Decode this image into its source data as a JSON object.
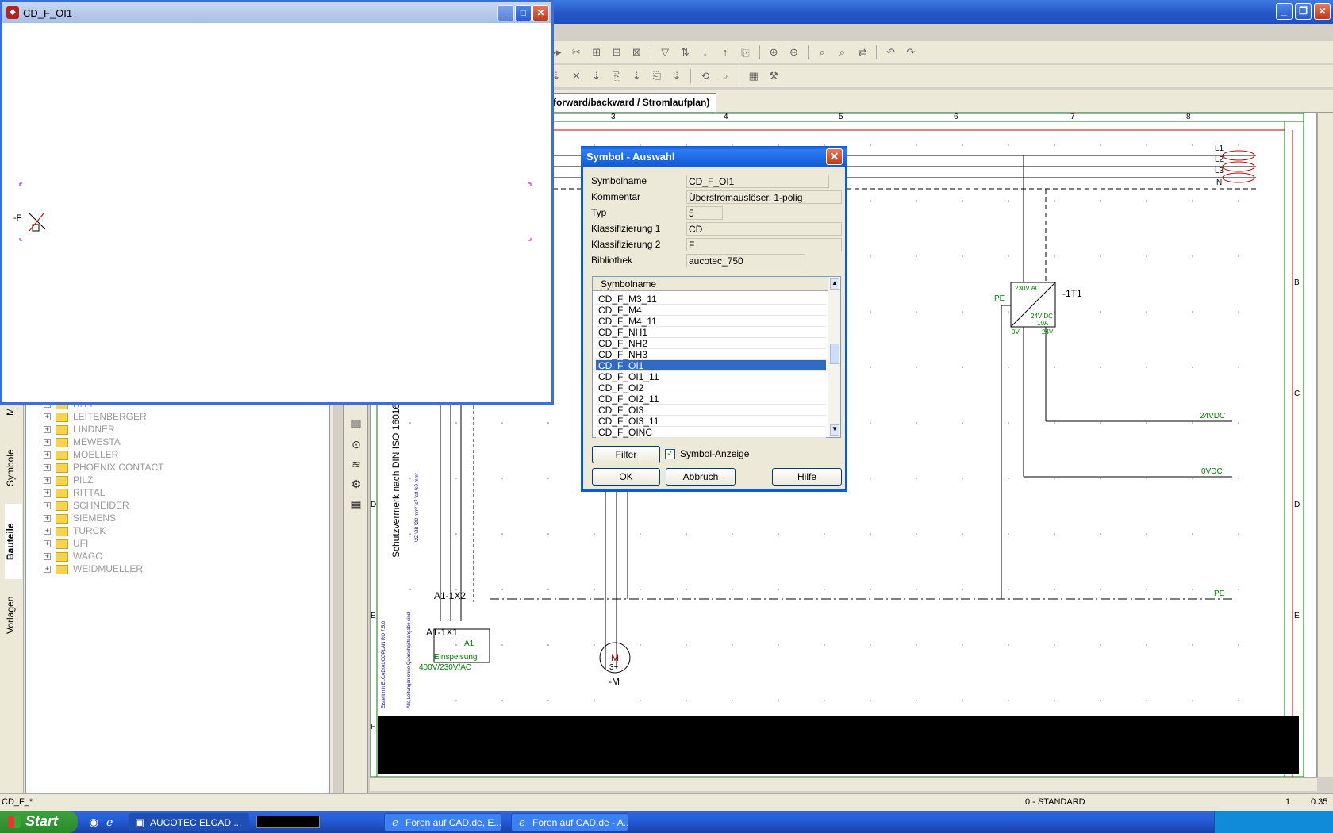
{
  "preview_window": {
    "title": "CD_F_OI1",
    "symbol_label": "-F"
  },
  "main_window": {
    "tab_label": "forward/backward / Stromlaufplan)"
  },
  "left_panel": {
    "tabs": [
      "Vorlagen",
      "Bauteile",
      "Symbole"
    ],
    "tree_items": [
      "RITT",
      "LEITENBERGER",
      "LINDNER",
      "MEWESTA",
      "MOELLER",
      "PHOENIX CONTACT",
      "PILZ",
      "RITTAL",
      "SCHNEIDER",
      "SIEMENS",
      "TURCK",
      "UFI",
      "WAGO",
      "WEIDMUELLER"
    ]
  },
  "drawing": {
    "column_numbers": [
      "3",
      "4",
      "5",
      "6",
      "7",
      "8"
    ],
    "row_letters_right": [
      "B",
      "C",
      "D",
      "E"
    ],
    "row_letters_left": [
      "D",
      "E",
      "F"
    ],
    "phase_labels": [
      "L1",
      "L2",
      "L3",
      "N"
    ],
    "transformer": {
      "name": "-1T1",
      "in": "230V AC",
      "out": "24V DC",
      "current": "10A",
      "pe": "PE",
      "zero": "0V",
      "24v": "24V"
    },
    "outputs": [
      "24VDC",
      "0VDC",
      "PE"
    ],
    "connector": {
      "x2": "A1-1X2",
      "x1": "A1-1X1",
      "a1": "A1",
      "feed": "Einspeisung",
      "voltage": "400V/230V/AC"
    },
    "motor": {
      "name": "-M",
      "letter": "M",
      "phase": "3~"
    },
    "vertical_note": "Schutzvermerk nach DIN ISO 16016",
    "small_note_1": "Erstellt mit ELCAD/AUCOPLAN RO 7.5.0",
    "small_note_2": "Alle Leitungen ohne Querschnittsangabe sind",
    "small_note_3": "\\2Z \\2B \\2D mm² \\s7 \\s8 \\s9 mm²"
  },
  "dialog": {
    "title": "Symbol - Auswahl",
    "fields": [
      {
        "label": "Symbolname",
        "value": "CD_F_OI1"
      },
      {
        "label": "Kommentar",
        "value": "Überstromauslöser, 1-polig"
      },
      {
        "label": "Typ",
        "value": "5"
      },
      {
        "label": "Klassifizierung 1",
        "value": "CD"
      },
      {
        "label": "Klassifizierung 2",
        "value": "F"
      },
      {
        "label": "Bibliothek",
        "value": "aucotec_750"
      }
    ],
    "list_header": "Symbolname",
    "list_items": [
      "CD_F_M3_11",
      "CD_F_M4",
      "CD_F_M4_11",
      "CD_F_NH1",
      "CD_F_NH2",
      "CD_F_NH3",
      "CD_F_OI1",
      "CD_F_OI1_11",
      "CD_F_OI2",
      "CD_F_OI2_11",
      "CD_F_OI3",
      "CD_F_OI3_11",
      "CD_F_OINC"
    ],
    "selected_index": 6,
    "filter_button": "Filter",
    "checkbox_label": "Symbol-Anzeige",
    "checkbox_checked": true,
    "ok_button": "OK",
    "cancel_button": "Abbruch",
    "help_button": "Hilfe"
  },
  "status_bar": {
    "left": "CD_F_*",
    "layer": "0 - STANDARD",
    "scale": "1",
    "coord": "0.35"
  },
  "taskbar": {
    "start": "Start",
    "tasks": [
      "AUCOTEC    ELCAD ...",
      "Foren auf CAD.de, E...",
      "Foren auf CAD.de - A..."
    ]
  },
  "colors": {
    "drawing_green": "#008000",
    "dialog_blue": "#0a5bd8",
    "selection": "#316ac5"
  }
}
